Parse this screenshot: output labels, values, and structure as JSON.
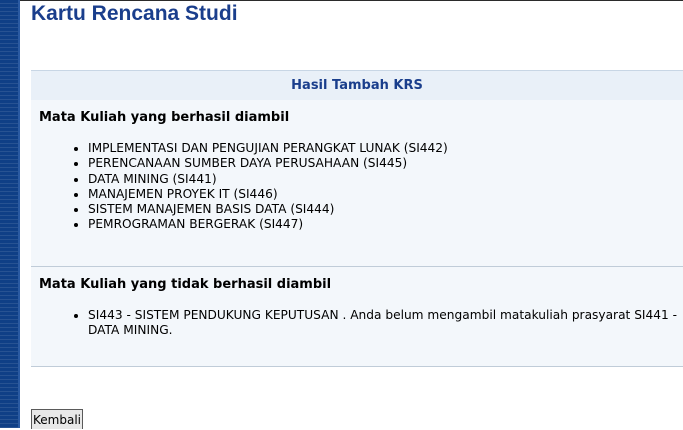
{
  "page": {
    "title": "Kartu Rencana Studi"
  },
  "panel": {
    "header": "Hasil Tambah KRS",
    "success": {
      "heading": "Mata Kuliah yang berhasil diambil",
      "items": [
        "IMPLEMENTASI DAN PENGUJIAN PERANGKAT LUNAK (SI442)",
        "PERENCANAAN SUMBER DAYA PERUSAHAAN (SI445)",
        "DATA MINING (SI441)",
        "MANAJEMEN PROYEK IT (SI446)",
        "SISTEM MANAJEMEN BASIS DATA (SI444)",
        "PEMROGRAMAN BERGERAK (SI447)"
      ]
    },
    "failed": {
      "heading": "Mata Kuliah yang tidak berhasil diambil",
      "items": [
        "SI443 - SISTEM PENDUKUNG KEPUTUSAN . Anda belum mengambil matakuliah prasyarat SI441 - DATA MINING."
      ]
    }
  },
  "actions": {
    "back_label": "Kembali"
  },
  "colors": {
    "title": "#1a3e8c",
    "sidebar": "#0f3f86",
    "panel_bg": "#f3f7fb",
    "header_bg": "#e9f0f8"
  }
}
